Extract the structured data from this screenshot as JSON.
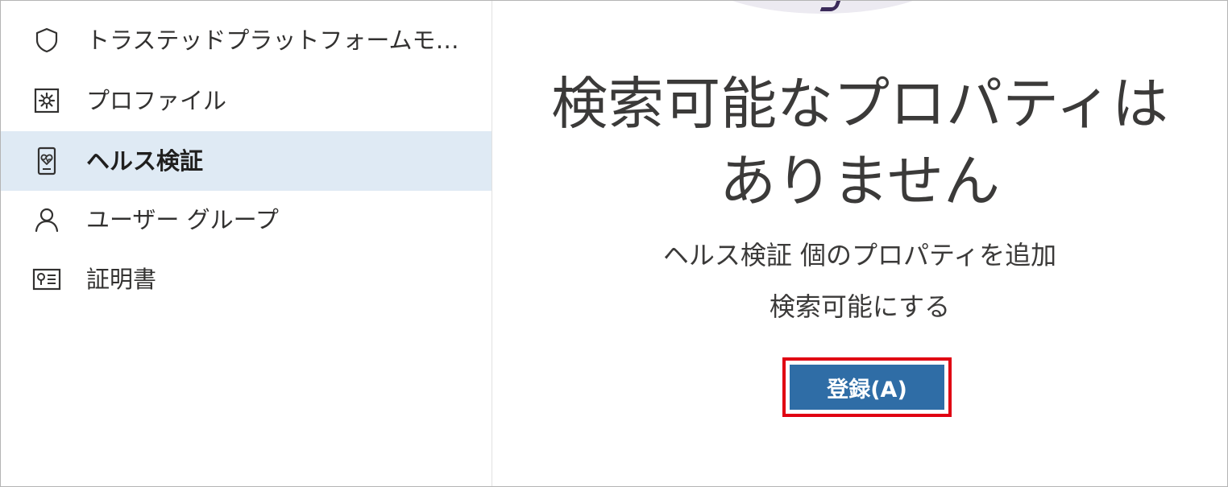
{
  "sidebar": {
    "items": [
      {
        "label": "トラステッドプラットフォームモジュール",
        "icon": "shield-icon",
        "selected": false
      },
      {
        "label": "プロファイル",
        "icon": "profile-settings-icon",
        "selected": false
      },
      {
        "label": "ヘルス検証",
        "icon": "health-device-icon",
        "selected": true
      },
      {
        "label": "ユーザー グループ",
        "icon": "user-icon",
        "selected": false
      },
      {
        "label": "証明書",
        "icon": "certificate-icon",
        "selected": false
      }
    ]
  },
  "main": {
    "headline_line1": "検索可能なプロパティは",
    "headline_line2": "ありません",
    "subtext_line1": "ヘルス検証 個のプロパティを追加",
    "subtext_line2": "検索可能にする",
    "register_label": "登録(A)"
  },
  "colors": {
    "selected_bg": "#dfeaf4",
    "button_bg": "#2f6da6",
    "highlight_border": "#e00012",
    "text": "#323130"
  }
}
